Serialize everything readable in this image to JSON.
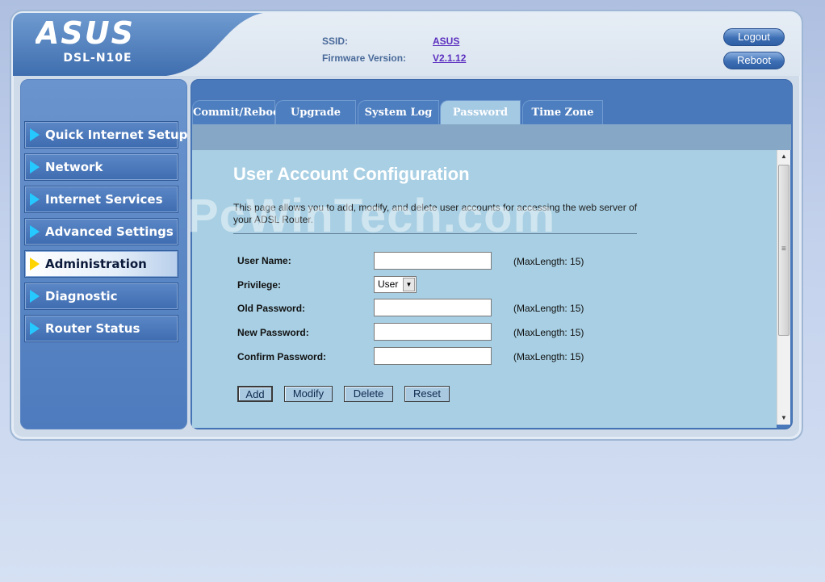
{
  "brand": {
    "logo_text": "ASUS",
    "model": "DSL-N10E"
  },
  "header": {
    "ssid_label": "SSID:",
    "ssid_value": "ASUS",
    "firmware_label": "Firmware Version:",
    "firmware_value": "V2.1.12",
    "logout_label": "Logout",
    "reboot_label": "Reboot"
  },
  "sidebar": {
    "items": [
      {
        "label": "Quick Internet Setup",
        "active": false
      },
      {
        "label": "Network",
        "active": false
      },
      {
        "label": "Internet Services",
        "active": false
      },
      {
        "label": "Advanced Settings",
        "active": false
      },
      {
        "label": "Administration",
        "active": true
      },
      {
        "label": "Diagnostic",
        "active": false
      },
      {
        "label": "Router Status",
        "active": false
      }
    ]
  },
  "tabs": [
    {
      "label": "Commit/Reboot",
      "active": false
    },
    {
      "label": "Upgrade",
      "active": false
    },
    {
      "label": "System Log",
      "active": false
    },
    {
      "label": "Password",
      "active": true
    },
    {
      "label": "Time Zone",
      "active": false
    }
  ],
  "main": {
    "title": "User Account Configuration",
    "description": "This page allows you to add, modify, and delete user accounts for accessing the web server of your ADSL Router.",
    "watermark": "PcWinTech.com",
    "fields": {
      "user_name": {
        "label": "User Name:",
        "value": "",
        "note": "(MaxLength: 15)"
      },
      "privilege": {
        "label": "Privilege:",
        "value": "User"
      },
      "old_password": {
        "label": "Old Password:",
        "value": "",
        "note": "(MaxLength: 15)"
      },
      "new_password": {
        "label": "New Password:",
        "value": "",
        "note": "(MaxLength: 15)"
      },
      "confirm_password": {
        "label": "Confirm Password:",
        "value": "",
        "note": "(MaxLength: 15)"
      }
    },
    "buttons": {
      "add": "Add",
      "modify": "Modify",
      "delete": "Delete",
      "reset": "Reset"
    }
  },
  "colors": {
    "accent_blue": "#4a79bb",
    "panel_bg": "#a8cfe3",
    "active_arrow": "#ffd400",
    "menu_arrow": "#25c8ff"
  }
}
